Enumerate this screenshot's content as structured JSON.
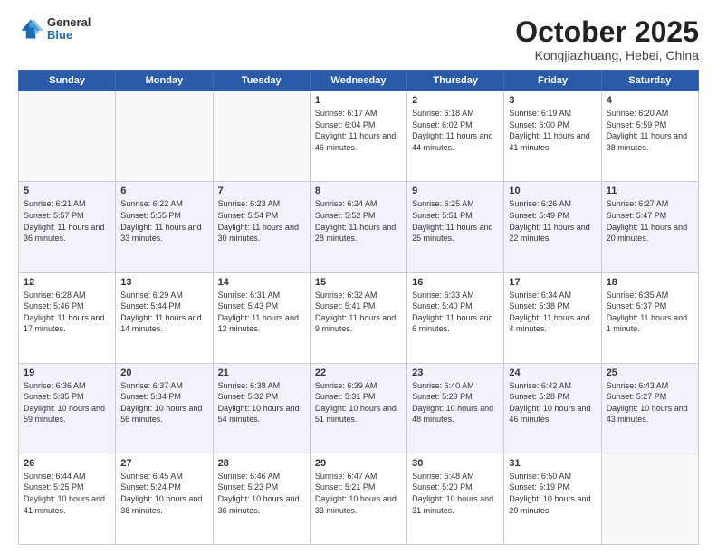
{
  "header": {
    "logo": {
      "general": "General",
      "blue": "Blue"
    },
    "title": "October 2025",
    "subtitle": "Kongjiazhuang, Hebei, China"
  },
  "calendar": {
    "days_of_week": [
      "Sunday",
      "Monday",
      "Tuesday",
      "Wednesday",
      "Thursday",
      "Friday",
      "Saturday"
    ],
    "weeks": [
      [
        {
          "day": "",
          "empty": true
        },
        {
          "day": "",
          "empty": true
        },
        {
          "day": "",
          "empty": true
        },
        {
          "day": "1",
          "sunrise": "6:17 AM",
          "sunset": "6:04 PM",
          "daylight": "11 hours and 46 minutes."
        },
        {
          "day": "2",
          "sunrise": "6:18 AM",
          "sunset": "6:02 PM",
          "daylight": "11 hours and 44 minutes."
        },
        {
          "day": "3",
          "sunrise": "6:19 AM",
          "sunset": "6:00 PM",
          "daylight": "11 hours and 41 minutes."
        },
        {
          "day": "4",
          "sunrise": "6:20 AM",
          "sunset": "5:59 PM",
          "daylight": "11 hours and 38 minutes."
        }
      ],
      [
        {
          "day": "5",
          "sunrise": "6:21 AM",
          "sunset": "5:57 PM",
          "daylight": "11 hours and 36 minutes."
        },
        {
          "day": "6",
          "sunrise": "6:22 AM",
          "sunset": "5:55 PM",
          "daylight": "11 hours and 33 minutes."
        },
        {
          "day": "7",
          "sunrise": "6:23 AM",
          "sunset": "5:54 PM",
          "daylight": "11 hours and 30 minutes."
        },
        {
          "day": "8",
          "sunrise": "6:24 AM",
          "sunset": "5:52 PM",
          "daylight": "11 hours and 28 minutes."
        },
        {
          "day": "9",
          "sunrise": "6:25 AM",
          "sunset": "5:51 PM",
          "daylight": "11 hours and 25 minutes."
        },
        {
          "day": "10",
          "sunrise": "6:26 AM",
          "sunset": "5:49 PM",
          "daylight": "11 hours and 22 minutes."
        },
        {
          "day": "11",
          "sunrise": "6:27 AM",
          "sunset": "5:47 PM",
          "daylight": "11 hours and 20 minutes."
        }
      ],
      [
        {
          "day": "12",
          "sunrise": "6:28 AM",
          "sunset": "5:46 PM",
          "daylight": "11 hours and 17 minutes."
        },
        {
          "day": "13",
          "sunrise": "6:29 AM",
          "sunset": "5:44 PM",
          "daylight": "11 hours and 14 minutes."
        },
        {
          "day": "14",
          "sunrise": "6:31 AM",
          "sunset": "5:43 PM",
          "daylight": "11 hours and 12 minutes."
        },
        {
          "day": "15",
          "sunrise": "6:32 AM",
          "sunset": "5:41 PM",
          "daylight": "11 hours and 9 minutes."
        },
        {
          "day": "16",
          "sunrise": "6:33 AM",
          "sunset": "5:40 PM",
          "daylight": "11 hours and 6 minutes."
        },
        {
          "day": "17",
          "sunrise": "6:34 AM",
          "sunset": "5:38 PM",
          "daylight": "11 hours and 4 minutes."
        },
        {
          "day": "18",
          "sunrise": "6:35 AM",
          "sunset": "5:37 PM",
          "daylight": "11 hours and 1 minute."
        }
      ],
      [
        {
          "day": "19",
          "sunrise": "6:36 AM",
          "sunset": "5:35 PM",
          "daylight": "10 hours and 59 minutes."
        },
        {
          "day": "20",
          "sunrise": "6:37 AM",
          "sunset": "5:34 PM",
          "daylight": "10 hours and 56 minutes."
        },
        {
          "day": "21",
          "sunrise": "6:38 AM",
          "sunset": "5:32 PM",
          "daylight": "10 hours and 54 minutes."
        },
        {
          "day": "22",
          "sunrise": "6:39 AM",
          "sunset": "5:31 PM",
          "daylight": "10 hours and 51 minutes."
        },
        {
          "day": "23",
          "sunrise": "6:40 AM",
          "sunset": "5:29 PM",
          "daylight": "10 hours and 48 minutes."
        },
        {
          "day": "24",
          "sunrise": "6:42 AM",
          "sunset": "5:28 PM",
          "daylight": "10 hours and 46 minutes."
        },
        {
          "day": "25",
          "sunrise": "6:43 AM",
          "sunset": "5:27 PM",
          "daylight": "10 hours and 43 minutes."
        }
      ],
      [
        {
          "day": "26",
          "sunrise": "6:44 AM",
          "sunset": "5:25 PM",
          "daylight": "10 hours and 41 minutes."
        },
        {
          "day": "27",
          "sunrise": "6:45 AM",
          "sunset": "5:24 PM",
          "daylight": "10 hours and 38 minutes."
        },
        {
          "day": "28",
          "sunrise": "6:46 AM",
          "sunset": "5:23 PM",
          "daylight": "10 hours and 36 minutes."
        },
        {
          "day": "29",
          "sunrise": "6:47 AM",
          "sunset": "5:21 PM",
          "daylight": "10 hours and 33 minutes."
        },
        {
          "day": "30",
          "sunrise": "6:48 AM",
          "sunset": "5:20 PM",
          "daylight": "10 hours and 31 minutes."
        },
        {
          "day": "31",
          "sunrise": "6:50 AM",
          "sunset": "5:19 PM",
          "daylight": "10 hours and 29 minutes."
        },
        {
          "day": "",
          "empty": true
        }
      ]
    ]
  }
}
